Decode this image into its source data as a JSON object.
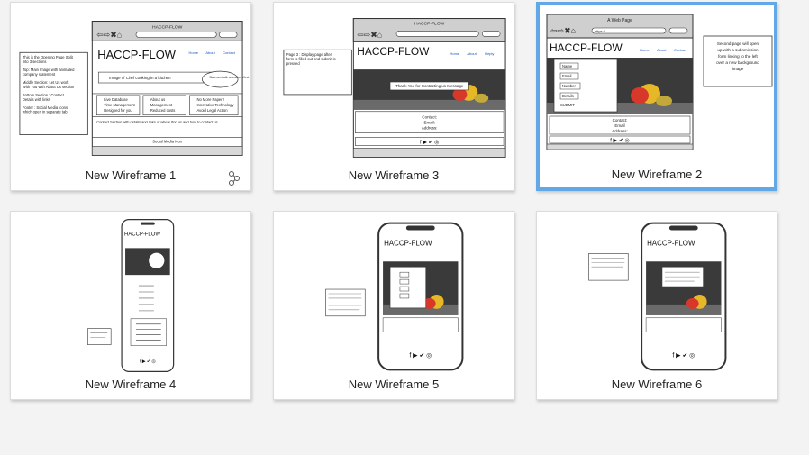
{
  "wireframes": [
    {
      "name": "New Wireframe 1"
    },
    {
      "name": "New Wireframe 3"
    },
    {
      "name": "New Wireframe 2"
    },
    {
      "name": "New Wireframe 4"
    },
    {
      "name": "New Wireframe 5"
    },
    {
      "name": "New Wireframe 6"
    }
  ],
  "thumbs": {
    "browser_title": "HACCP-FLOW",
    "brand": "HACCP-FLOW",
    "nav": [
      "Home",
      "About",
      "Contact"
    ],
    "nav3": [
      "Home",
      "About",
      "Reply"
    ],
    "wf1": {
      "note": [
        "This is the Opening Page Split",
        "into 3 sections",
        "Top: Main Image with animated",
        "company statement",
        "Middle Section: Let Us work",
        "With You with About Us section",
        "Bottom Section : Contact",
        "Details with links",
        "Footer : Social Media icons",
        "which open in separate tab"
      ],
      "hero_caption": "Image of Chef cooking in a kitchen",
      "statement": "Statement with animation effect",
      "features_a": [
        "Live Database",
        "Time Management",
        "Designed for you"
      ],
      "features_b": [
        "About us",
        "Management",
        "Reduced costs"
      ],
      "features_c": [
        "No More Paper!!",
        "Innovative Technology",
        "Avoid Legal Action"
      ],
      "contact_text": "Contact Section with details and links of where find us and how to contact us",
      "social_text": "Social Media Icon"
    },
    "wf3": {
      "note": [
        "Page 3 : Display page after",
        "form is filled out and submit is",
        "pressed"
      ],
      "thanks": "Thank You for Contacting us Message",
      "contact": [
        "Contact:",
        "Email:",
        "Address:"
      ]
    },
    "wf2": {
      "browser_title": "A Web Page",
      "url": "https://",
      "form": [
        "Name",
        "Email",
        "Number",
        "Details"
      ],
      "submit": "SUBMIT",
      "contact": [
        "Contact:",
        "Email",
        "Address:"
      ],
      "note": [
        "Second page will open",
        "up with a subnmission",
        "form linking to the left",
        "over a new background",
        "image"
      ]
    }
  }
}
